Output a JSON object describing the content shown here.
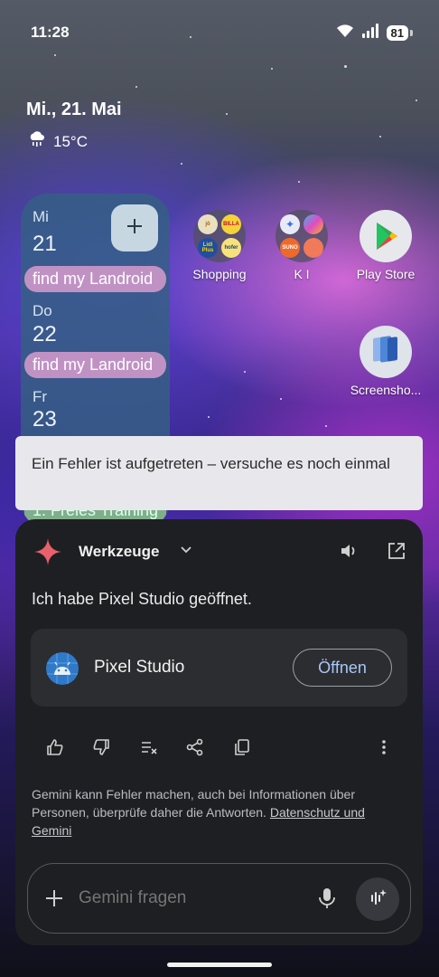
{
  "status_bar": {
    "time": "11:28",
    "battery": "81"
  },
  "date_widget": {
    "date": "Mi., 21. Mai",
    "temperature": "15°C"
  },
  "calendar": {
    "days": [
      {
        "name": "Mi",
        "number": "21",
        "event": "find my Landroid"
      },
      {
        "name": "Do",
        "number": "22",
        "event": "find my Landroid"
      },
      {
        "name": "Fr",
        "number": "23",
        "event": "1. Freies Training"
      }
    ]
  },
  "apps": {
    "shopping": {
      "label": "Shopping",
      "minis": [
        "jö",
        "BILLA",
        "Lidl Plus",
        "hofer"
      ]
    },
    "ki": {
      "label": "K I",
      "minis": [
        "Gemini",
        "Copilot",
        "SUNO",
        "Perplexity"
      ]
    },
    "play_store": {
      "label": "Play Store"
    },
    "screenshots": {
      "label": "Screensho..."
    }
  },
  "toast": {
    "text": "Ein Fehler ist aufgetreten – versuche es noch einmal"
  },
  "gemini": {
    "tools_label": "Werkzeuge",
    "message": "Ich habe Pixel Studio geöffnet.",
    "card": {
      "title": "Pixel Studio",
      "button": "Öffnen"
    },
    "disclaimer": "Gemini kann Fehler machen, auch bei Informationen über Personen, überprüfe daher die Antworten.",
    "privacy_link": "Datenschutz und Gemini",
    "input_placeholder": "Gemini fragen"
  },
  "colors": {
    "accent_link": "#a8c7fa",
    "sheet_bg": "#1e1f22",
    "card_bg": "#2c2d30",
    "calendar_bg": "#346082",
    "event_bg": "#c092c4"
  }
}
